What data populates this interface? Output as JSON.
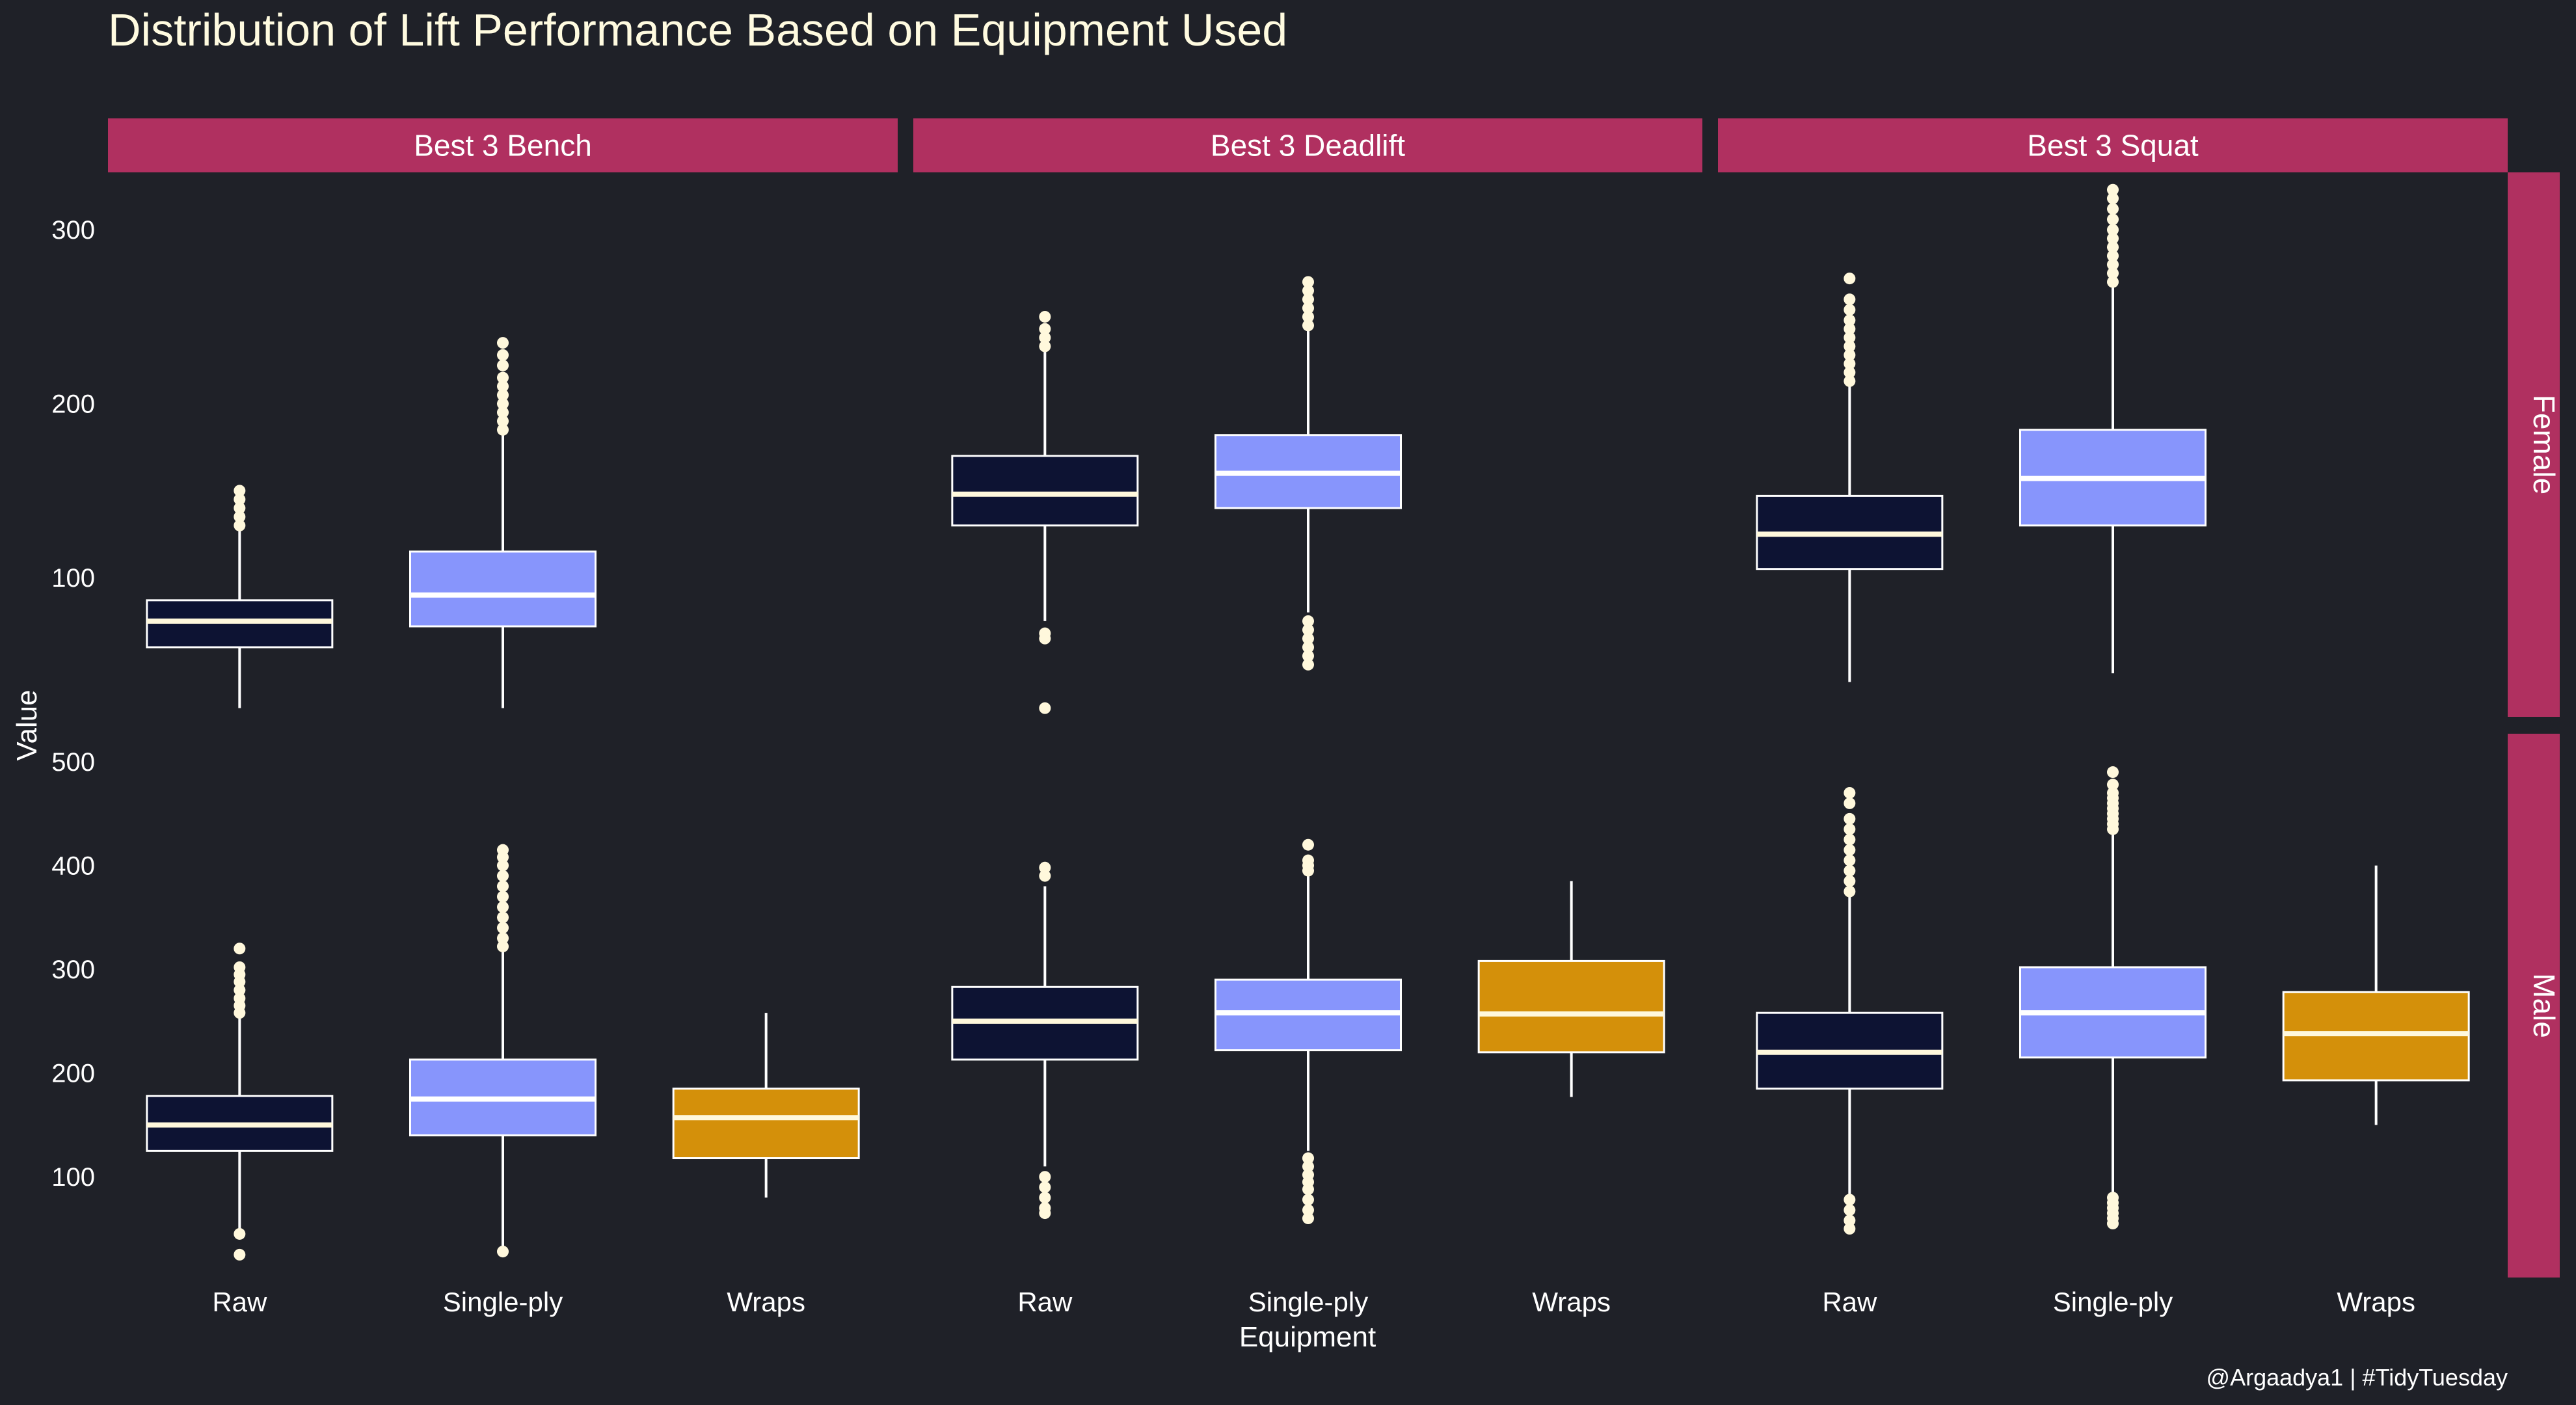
{
  "theme": {
    "background": "#1f2128",
    "strip_fill": "#b03060",
    "text_color": "#ffffff",
    "title_color": "#fffbe0",
    "outlier_color": "#fff8dc",
    "line_color": "#ffffff"
  },
  "chart_data": {
    "type": "boxplot",
    "title": "Distribution of Lift Performance Based on Equipment Used",
    "xlabel": "Equipment",
    "ylabel": "Value",
    "caption": "@Argaadya1 | #TidyTuesday",
    "facet_cols": [
      "Best 3 Bench",
      "Best 3 Deadlift",
      "Best 3 Squat"
    ],
    "facet_rows": [
      "Female",
      "Male"
    ],
    "categories": [
      "Raw",
      "Single-ply",
      "Wraps"
    ],
    "category_colors": {
      "Raw": "#0d1333",
      "Single-ply": "#8795fc",
      "Wraps": "#d4900a"
    },
    "median_colors": {
      "Raw": "#fff8dc",
      "Single-ply": "#ffffff",
      "Wraps": "#fff8dc"
    },
    "rows": [
      {
        "name": "Female",
        "ylim": [
          20,
          333
        ],
        "yticks": [
          100,
          200,
          300
        ],
        "panels": [
          {
            "facet": "Best 3 Bench",
            "boxes": [
              {
                "category": "Raw",
                "whisker_low": 25,
                "q1": 60,
                "median": 75,
                "q3": 87,
                "whisker_high": 128,
                "outliers": [
                  130,
                  135,
                  140,
                  145,
                  150
                ]
              },
              {
                "category": "Single-ply",
                "whisker_low": 25,
                "q1": 72,
                "median": 90,
                "q3": 115,
                "whisker_high": 183,
                "outliers": [
                  185,
                  190,
                  195,
                  200,
                  205,
                  210,
                  215,
                  222,
                  228,
                  235
                ]
              }
            ]
          },
          {
            "facet": "Best 3 Deadlift",
            "boxes": [
              {
                "category": "Raw",
                "whisker_low": 75,
                "q1": 130,
                "median": 148,
                "q3": 170,
                "whisker_high": 230,
                "outliers": [
                  25,
                  65,
                  68,
                  233,
                  238,
                  243,
                  250
                ]
              },
              {
                "category": "Single-ply",
                "whisker_low": 80,
                "q1": 140,
                "median": 160,
                "q3": 182,
                "whisker_high": 243,
                "outliers": [
                  50,
                  55,
                  60,
                  65,
                  70,
                  75,
                  245,
                  250,
                  255,
                  260,
                  265,
                  270
                ]
              }
            ]
          },
          {
            "facet": "Best 3 Squat",
            "boxes": [
              {
                "category": "Raw",
                "whisker_low": 40,
                "q1": 105,
                "median": 125,
                "q3": 147,
                "whisker_high": 210,
                "outliers": [
                  213,
                  218,
                  223,
                  228,
                  233,
                  238,
                  243,
                  248,
                  254,
                  260,
                  272
                ]
              },
              {
                "category": "Single-ply",
                "whisker_low": 45,
                "q1": 130,
                "median": 157,
                "q3": 185,
                "whisker_high": 268,
                "outliers": [
                  270,
                  275,
                  280,
                  285,
                  290,
                  295,
                  300,
                  306,
                  312,
                  318,
                  323
                ]
              }
            ]
          }
        ]
      },
      {
        "name": "Male",
        "ylim": [
          3,
          527
        ],
        "yticks": [
          100,
          200,
          300,
          400,
          500
        ],
        "panels": [
          {
            "facet": "Best 3 Bench",
            "boxes": [
              {
                "category": "Raw",
                "whisker_low": 45,
                "q1": 125,
                "median": 150,
                "q3": 178,
                "whisker_high": 255,
                "outliers": [
                  25,
                  45,
                  258,
                  265,
                  272,
                  280,
                  288,
                  295,
                  302,
                  320
                ]
              },
              {
                "category": "Single-ply",
                "whisker_low": 30,
                "q1": 140,
                "median": 175,
                "q3": 213,
                "whisker_high": 320,
                "outliers": [
                  28,
                  322,
                  330,
                  340,
                  350,
                  360,
                  370,
                  380,
                  390,
                  400,
                  408,
                  415
                ]
              },
              {
                "category": "Wraps",
                "whisker_low": 80,
                "q1": 118,
                "median": 157,
                "q3": 185,
                "whisker_high": 258,
                "outliers": []
              }
            ]
          },
          {
            "facet": "Best 3 Deadlift",
            "boxes": [
              {
                "category": "Raw",
                "whisker_low": 110,
                "q1": 213,
                "median": 250,
                "q3": 283,
                "whisker_high": 380,
                "outliers": [
                  65,
                  70,
                  80,
                  90,
                  100,
                  390,
                  398
                ]
              },
              {
                "category": "Single-ply",
                "whisker_low": 125,
                "q1": 222,
                "median": 258,
                "q3": 290,
                "whisker_high": 390,
                "outliers": [
                  60,
                  68,
                  78,
                  88,
                  95,
                  102,
                  110,
                  118,
                  395,
                  400,
                  405,
                  420
                ]
              },
              {
                "category": "Wraps",
                "whisker_low": 177,
                "q1": 220,
                "median": 257,
                "q3": 308,
                "whisker_high": 385,
                "outliers": []
              }
            ]
          },
          {
            "facet": "Best 3 Squat",
            "boxes": [
              {
                "category": "Raw",
                "whisker_low": 80,
                "q1": 185,
                "median": 220,
                "q3": 258,
                "whisker_high": 370,
                "outliers": [
                  50,
                  58,
                  68,
                  78,
                  375,
                  385,
                  395,
                  405,
                  415,
                  425,
                  435,
                  445,
                  460,
                  470
                ]
              },
              {
                "category": "Single-ply",
                "whisker_low": 85,
                "q1": 215,
                "median": 258,
                "q3": 302,
                "whisker_high": 430,
                "outliers": [
                  55,
                  60,
                  65,
                  70,
                  75,
                  80,
                  435,
                  440,
                  445,
                  450,
                  455,
                  460,
                  465,
                  470,
                  478,
                  490
                ]
              },
              {
                "category": "Wraps",
                "whisker_low": 150,
                "q1": 193,
                "median": 238,
                "q3": 278,
                "whisker_high": 400,
                "outliers": []
              }
            ]
          }
        ]
      }
    ]
  }
}
